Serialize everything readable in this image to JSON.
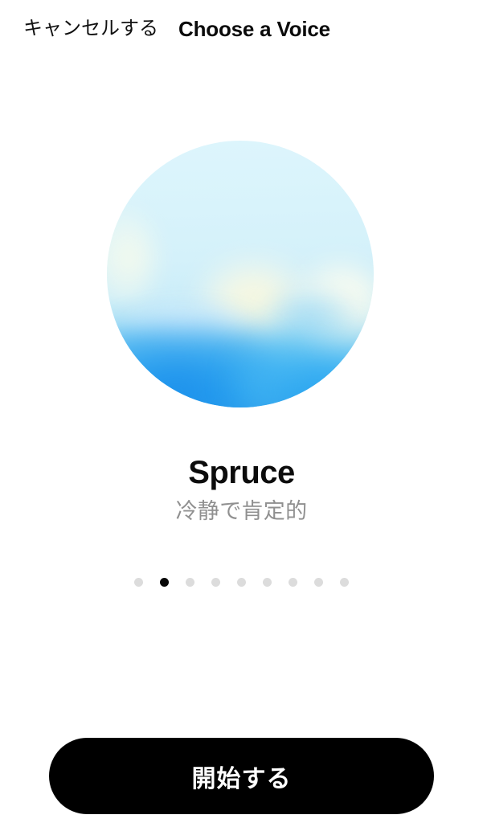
{
  "header": {
    "cancel_label": "キャンセルする",
    "title": "Choose a Voice"
  },
  "voice": {
    "name": "Spruce",
    "description": "冷静で肯定的",
    "orb_icon_name": "voice-orb",
    "orb_colors": {
      "top": "#ddf5fc",
      "mid": "#cdeef9",
      "bottom": "#2394e6",
      "glow_cream": "#fff8d6"
    }
  },
  "pager": {
    "total": 9,
    "active_index": 1,
    "dots": [
      {
        "label": "1",
        "active": false
      },
      {
        "label": "2",
        "active": true
      },
      {
        "label": "3",
        "active": false
      },
      {
        "label": "4",
        "active": false
      },
      {
        "label": "5",
        "active": false
      },
      {
        "label": "6",
        "active": false
      },
      {
        "label": "7",
        "active": false
      },
      {
        "label": "8",
        "active": false
      },
      {
        "label": "9",
        "active": false
      }
    ],
    "dot_color": "#dcdcdc",
    "active_dot_color": "#070707"
  },
  "cta": {
    "label": "開始する",
    "background": "#000000",
    "text_color": "#ffffff"
  },
  "page": {
    "background": "#ffffff"
  }
}
